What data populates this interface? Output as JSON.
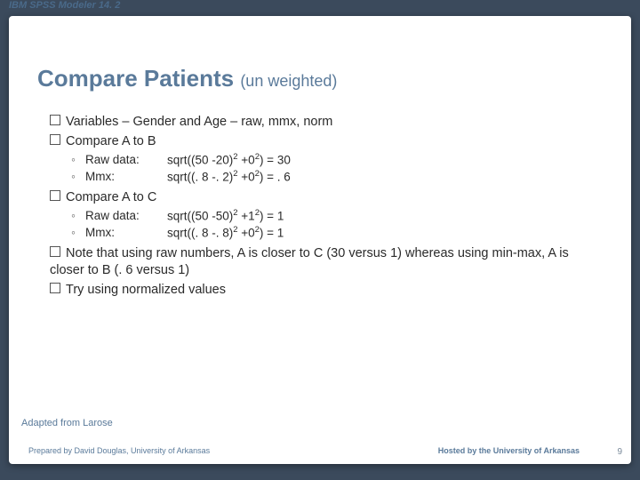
{
  "product": "IBM SPSS Modeler 14. 2",
  "title_main": "Compare Patients",
  "title_sub": "(un weighted)",
  "bullets": {
    "b1": "Variables – Gender and Age – raw, mmx, norm",
    "b2": "Compare A to B",
    "b2_sub": [
      {
        "label": "Raw data:",
        "formula_html": "sqrt((50 -20)<sup>2</sup> +0<sup>2</sup>) = 30"
      },
      {
        "label": "Mmx:",
        "formula_html": "sqrt((. 8 -. 2)<sup>2</sup> +0<sup>2</sup>) = . 6"
      }
    ],
    "b3": "Compare A to C",
    "b3_sub": [
      {
        "label": "Raw data:",
        "formula_html": "sqrt((50 -50)<sup>2</sup> +1<sup>2</sup>) = 1"
      },
      {
        "label": "Mmx:",
        "formula_html": "sqrt((. 8 -. 8)<sup>2</sup> +0<sup>2</sup>) = 1"
      }
    ],
    "b4": "Note that using raw numbers, A is closer to C (30 versus 1) whereas using min-max, A is closer to B (. 6 versus 1)",
    "b5": "Try using normalized values"
  },
  "adapted": "Adapted from Larose",
  "footer_left": "Prepared by David Douglas, University of Arkansas",
  "footer_right": "Hosted by the University of Arkansas",
  "page": "9"
}
